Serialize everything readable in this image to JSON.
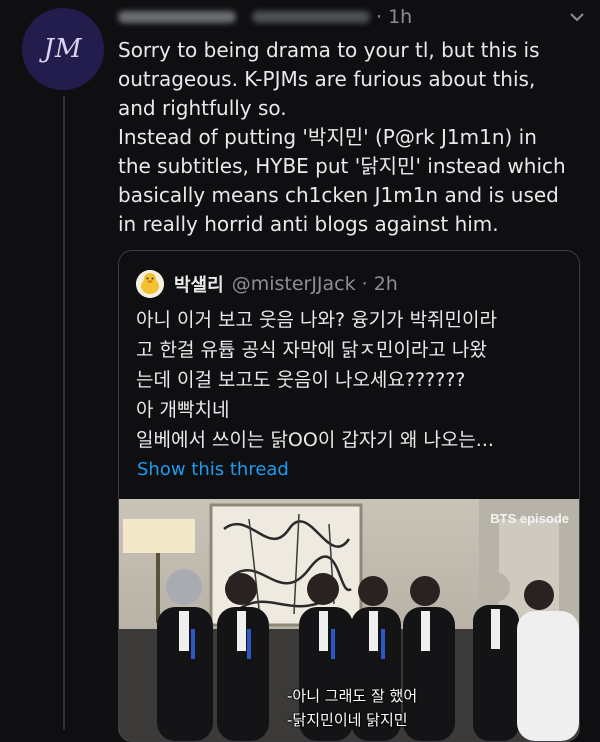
{
  "tweet": {
    "avatar_initials": "JM",
    "time": "· 1h",
    "more_icon": "more-icon",
    "lines": [
      "Sorry to being drama to your tl, but this is",
      "outrageous. K-PJMs are furious about this,",
      "and rightfully so.",
      "Instead of putting '박지민' (P@rk J1m1n) in",
      "the subtitles, HYBE put '닭지민' instead which",
      "basically means ch1cken J1m1n and is used",
      "in really horrid anti blogs against him."
    ]
  },
  "quote": {
    "name": "박샐리",
    "handle": "@misterJJack",
    "time": "· 2h",
    "lines": [
      "아니 이거 보고 웃음 나와? 융기가 박쥐민이라",
      "고 한걸 유튭 공식 자막에 닭ㅈ민이라고 나왔",
      "는데 이걸 보고도 웃음이 나오세요??????",
      "아 개빡치네",
      "일베에서 쓰이는 닭OO이 갑자기 왜 나오는..."
    ],
    "show_thread": "Show this thread"
  },
  "media": {
    "label": "BTS episode",
    "subtitle_1": "-아니 그래도 잘 했어",
    "subtitle_2": "-닭지민이네 닭지민"
  }
}
